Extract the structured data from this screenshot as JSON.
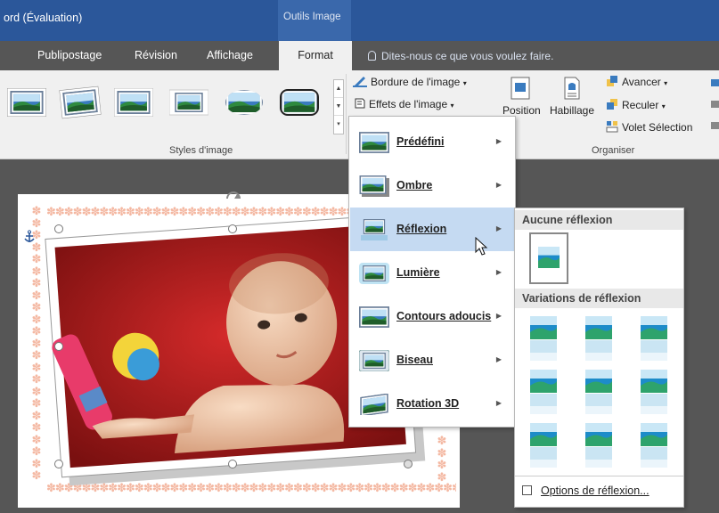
{
  "window": {
    "title": "ord (Évaluation)",
    "context_tab_group": "Outils Image"
  },
  "tabs": [
    {
      "label": "Publipostage"
    },
    {
      "label": "Révision"
    },
    {
      "label": "Affichage"
    },
    {
      "label": "Format"
    }
  ],
  "tell_me": "Dites-nous ce que vous voulez faire.",
  "ribbon": {
    "group_styles_label": "Styles d'image",
    "picture_border": "Bordure de l'image",
    "picture_effects": "Effets de l'image",
    "position": "Position",
    "wrap_text": "Habillage",
    "bring_forward": "Avancer",
    "send_backward": "Reculer",
    "selection_pane": "Volet Sélection",
    "group_arrange_label": "Organiser"
  },
  "effects_menu": {
    "items": [
      {
        "label": "Prédéfini"
      },
      {
        "label": "Ombre"
      },
      {
        "label": "Réflexion"
      },
      {
        "label": "Lumière"
      },
      {
        "label": "Contours adoucis"
      },
      {
        "label": "Biseau"
      },
      {
        "label": "Rotation 3D"
      }
    ],
    "active_index": 2
  },
  "reflection_submenu": {
    "no_reflection_header": "Aucune réflexion",
    "variations_header": "Variations de réflexion",
    "options_link": "Options de réflexion..."
  },
  "colors": {
    "title_bar": "#2b579a",
    "ribbon": "#f0f0f0",
    "menu_highlight": "#c5daf2",
    "page_border": "#f4b8a2"
  }
}
